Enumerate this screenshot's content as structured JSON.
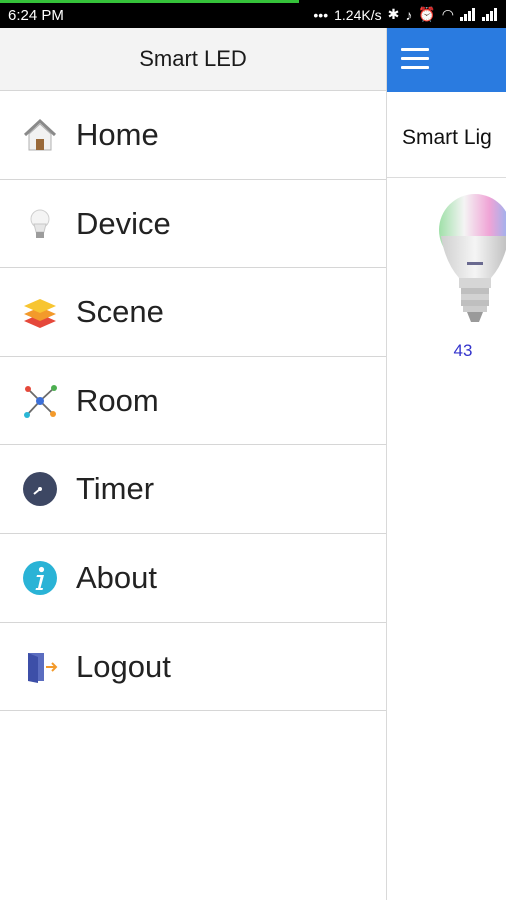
{
  "status_bar": {
    "time": "6:24 PM",
    "network_speed": "1.24K/s",
    "download_progress_percent": 59
  },
  "drawer": {
    "title": "Smart LED",
    "items": [
      {
        "label": "Home",
        "icon": "home-icon"
      },
      {
        "label": "Device",
        "icon": "bulb-icon"
      },
      {
        "label": "Scene",
        "icon": "layers-icon"
      },
      {
        "label": "Room",
        "icon": "network-icon"
      },
      {
        "label": "Timer",
        "icon": "clock-icon"
      },
      {
        "label": "About",
        "icon": "info-icon"
      },
      {
        "label": "Logout",
        "icon": "logout-door-icon"
      }
    ]
  },
  "main": {
    "subheader_text": "Smart Lig",
    "device": {
      "label": "43",
      "icon": "rgb-bulb-icon"
    }
  },
  "colors": {
    "appbar": "#2a7be0",
    "device_label": "#3333cc",
    "progress": "#35c23a"
  }
}
